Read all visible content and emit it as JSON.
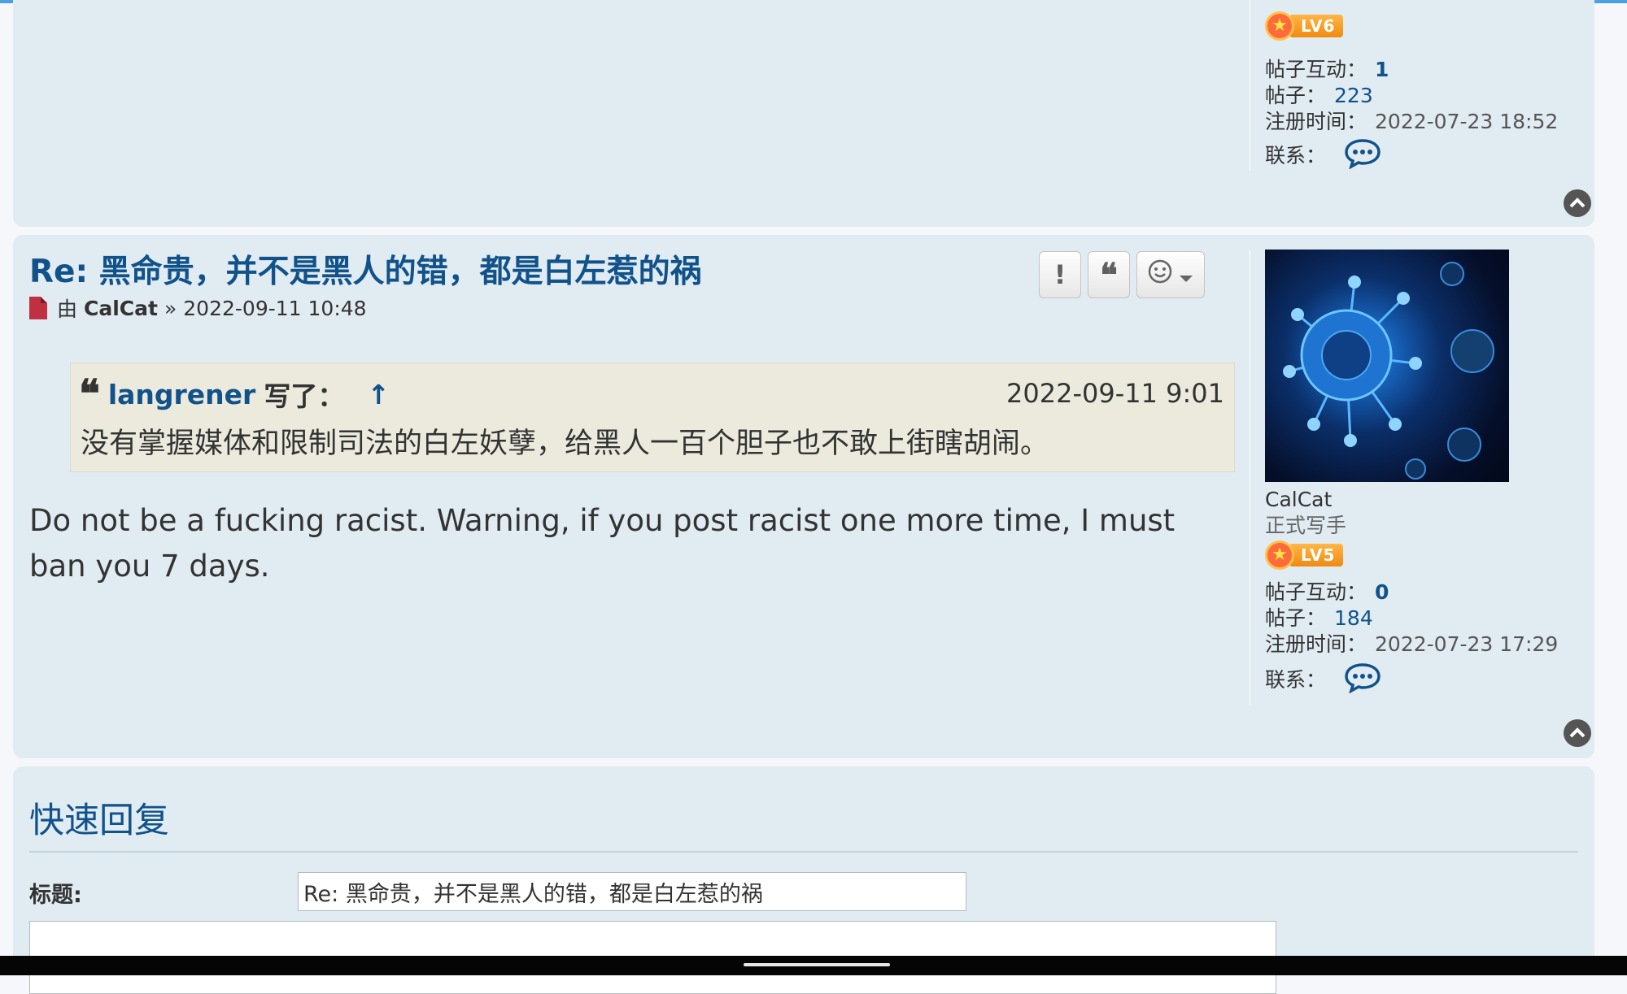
{
  "prev_post": {
    "rank_level": "LV6",
    "interaction_label": "帖子互动：",
    "interaction_value": "1",
    "posts_label": "帖子：",
    "posts_value": "223",
    "registered_label": "注册时间：",
    "registered_value": "2022-07-23 18:52",
    "contact_label": "联系："
  },
  "post": {
    "title": "Re: 黑命贵，并不是黑人的错，都是白左惹的祸",
    "by_label": "由",
    "author": "CalCat",
    "separator": "»",
    "datetime": "2022-09-11 10:48",
    "actions": {
      "report": "!",
      "quote": "❝"
    },
    "quote": {
      "author": "langrener",
      "wrote_label": "写了：",
      "up_arrow": "↑",
      "date": "2022-09-11 9:01",
      "text": "没有掌握媒体和限制司法的白左妖孽，给黑人一百个胆子也不敢上街瞎胡闹。"
    },
    "body": "Do not be a fucking racist. Warning, if you post racist one more time, I must ban you 7 days.",
    "profile": {
      "username": "CalCat",
      "rank_title": "正式写手",
      "rank_level": "LV5",
      "interaction_label": "帖子互动：",
      "interaction_value": "0",
      "posts_label": "帖子：",
      "posts_value": "184",
      "registered_label": "注册时间：",
      "registered_value": "2022-07-23 17:29",
      "contact_label": "联系："
    }
  },
  "quick_reply": {
    "heading": "快速回复",
    "subject_label": "标题:",
    "subject_value": "Re: 黑命贵，并不是黑人的错，都是白左惹的祸"
  },
  "icons": {
    "contact": "speech-bubble-icon",
    "back_to_top": "chevron-up-icon",
    "post_type": "document-icon",
    "react": "smiley-icon"
  },
  "colors": {
    "link": "#105289",
    "post_bg": "#e1ebf2",
    "quote_bg": "#ebeadd",
    "badge_orange": "#f08a12"
  }
}
